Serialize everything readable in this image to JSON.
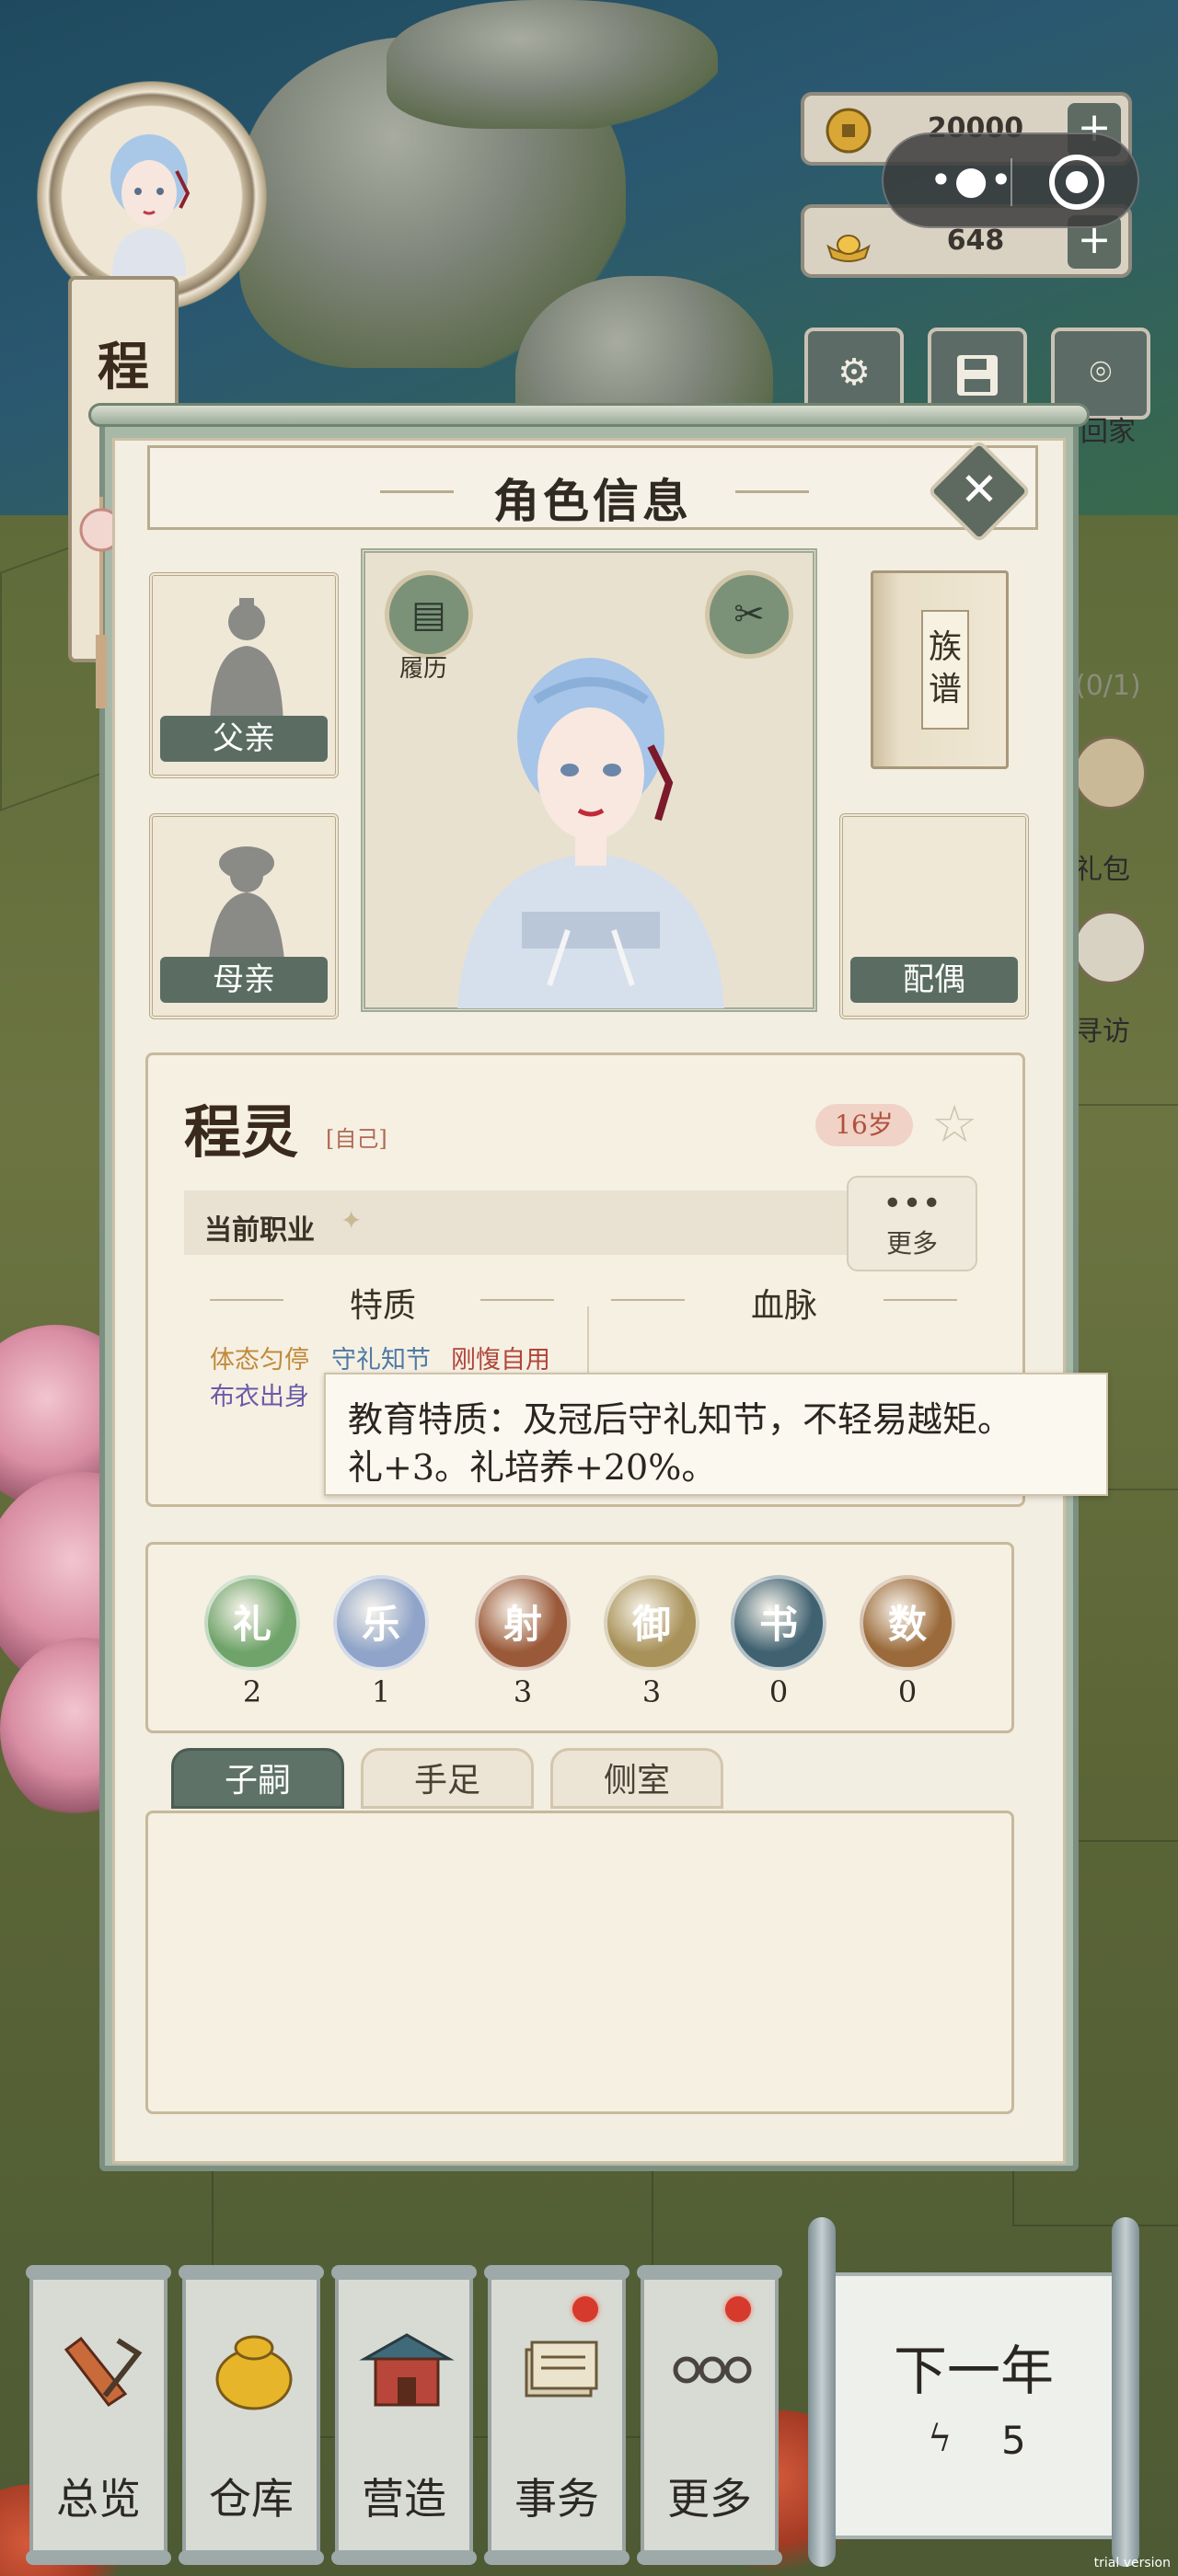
{
  "resources": {
    "coins": "20000",
    "ingots": "648",
    "plus": "+"
  },
  "player": {
    "name_char_1": "程",
    "name_char_2": "灵"
  },
  "side_labels": {
    "visit_home": "回家",
    "quest_count": "(0/1)",
    "gift": "礼包",
    "visit": "寻访"
  },
  "modal": {
    "title": "角色信息",
    "close": "✕",
    "father": "父亲",
    "mother": "母亲",
    "spouse": "配偶",
    "resume": "履历",
    "genealogy": "族谱"
  },
  "character": {
    "name": "程灵",
    "self_tag": "[自己]",
    "age": "16岁",
    "job_label": "当前职业",
    "more_dots": "•••",
    "more": "更多",
    "traits_title": "特质",
    "bloodline_title": "血脉",
    "traits": [
      {
        "text": "体态匀停",
        "color": "#c08a3a"
      },
      {
        "text": "守礼知节",
        "color": "#4c7aa3"
      },
      {
        "text": "刚愎自用",
        "color": "#b0453a"
      },
      {
        "text": "布衣出身",
        "color": "#6a5ba8"
      }
    ]
  },
  "tooltip": {
    "line1": "教育特质：及冠后守礼知节，不轻易越矩。",
    "line2": "礼+3。礼培养+20%。"
  },
  "skills": [
    {
      "name": "礼",
      "value": "2",
      "color": "#6fa36a"
    },
    {
      "name": "乐",
      "value": "1",
      "color": "#8fa4c8"
    },
    {
      "name": "射",
      "value": "3",
      "color": "#9a5a3a"
    },
    {
      "name": "御",
      "value": "3",
      "color": "#a8925a"
    },
    {
      "name": "书",
      "value": "0",
      "color": "#3f6170"
    },
    {
      "name": "数",
      "value": "0",
      "color": "#9a6a3a"
    }
  ],
  "tabs": [
    {
      "label": "子嗣",
      "active": true
    },
    {
      "label": "手足",
      "active": false
    },
    {
      "label": "侧室",
      "active": false
    }
  ],
  "bottom_nav": [
    {
      "label": "总览",
      "icon": "brush-icon",
      "badge": false
    },
    {
      "label": "仓库",
      "icon": "money-bag-icon",
      "badge": false
    },
    {
      "label": "营造",
      "icon": "building-icon",
      "badge": false
    },
    {
      "label": "事务",
      "icon": "documents-icon",
      "badge": true
    },
    {
      "label": "更多",
      "icon": "more-icon",
      "badge": true
    }
  ],
  "next_year": {
    "title": "下一年",
    "energy": "5"
  },
  "watermark": "trial version"
}
